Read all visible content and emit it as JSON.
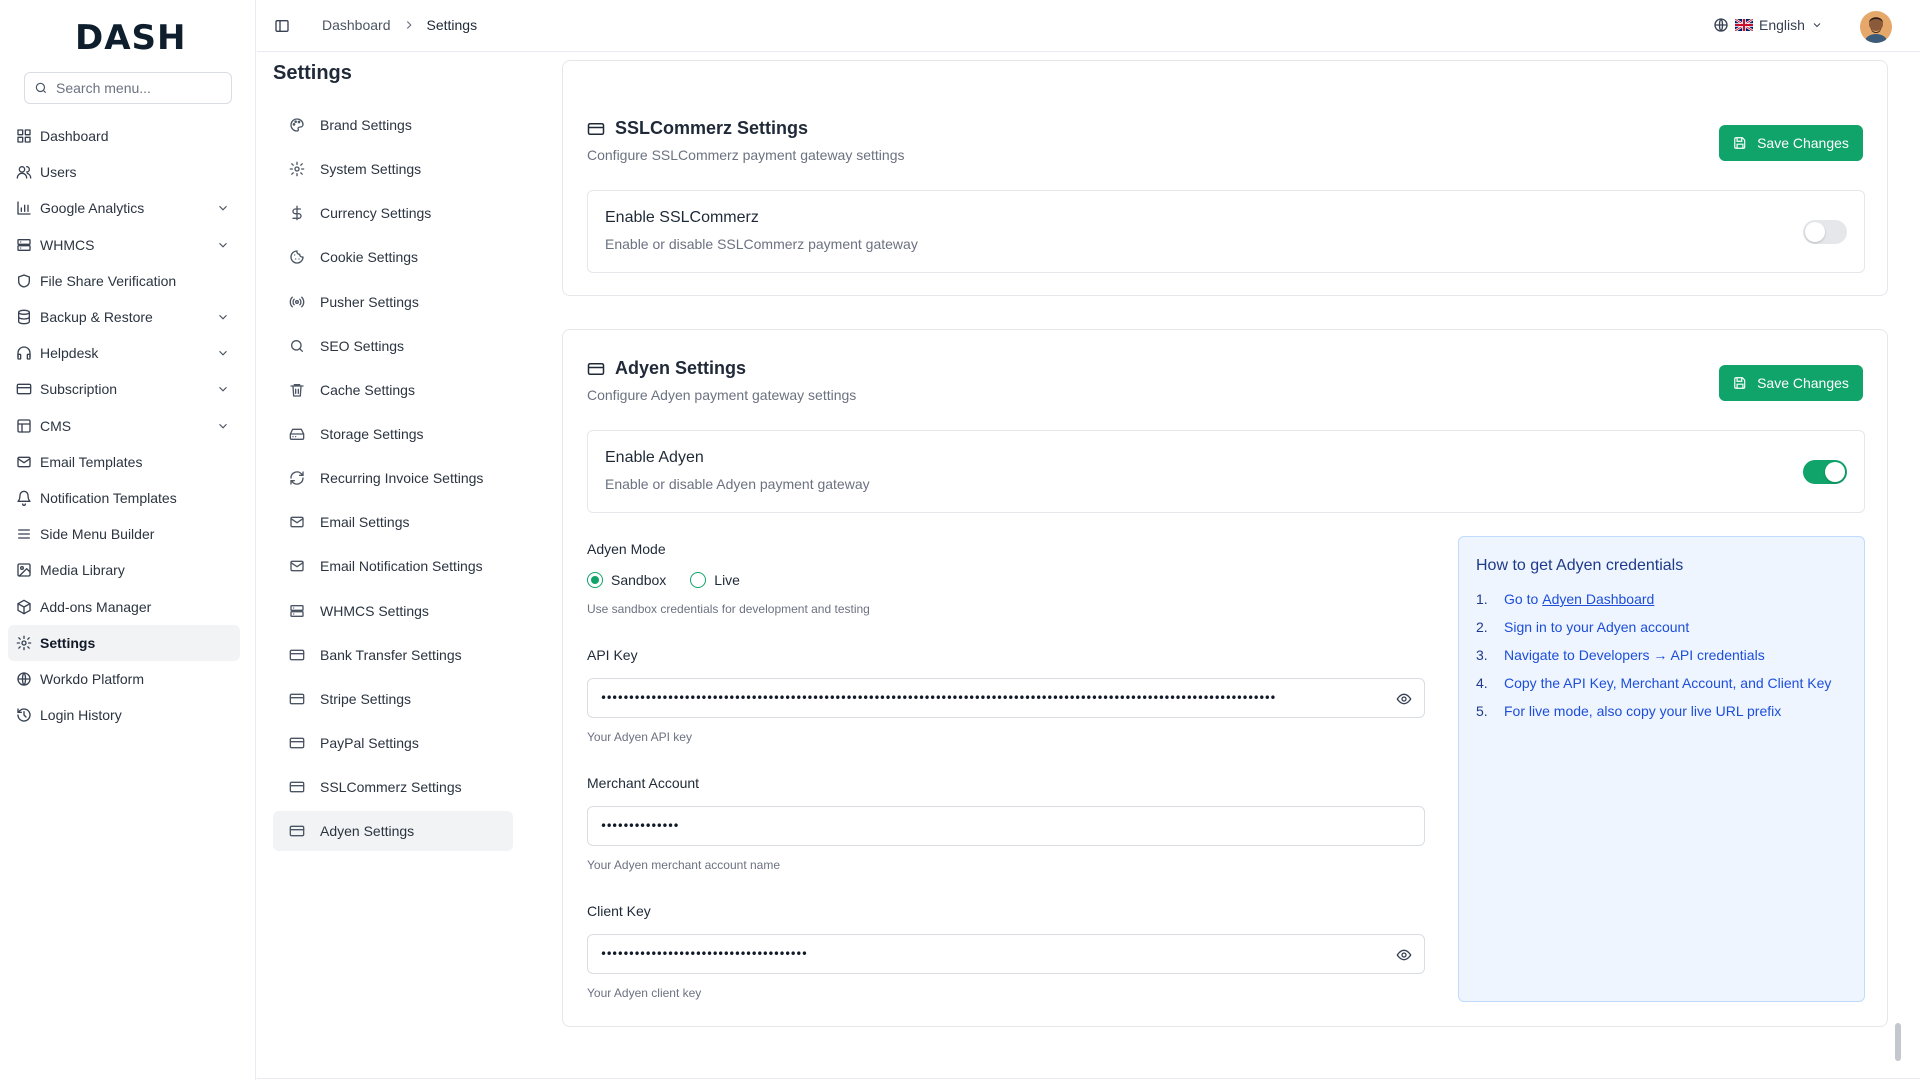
{
  "brand": {
    "logo_text": "DASH"
  },
  "search": {
    "placeholder": "Search menu..."
  },
  "sidebar": {
    "items": [
      {
        "label": "Dashboard",
        "icon": "grid-icon",
        "expandable": false
      },
      {
        "label": "Users",
        "icon": "users-icon",
        "expandable": false
      },
      {
        "label": "Google Analytics",
        "icon": "bar-chart-icon",
        "expandable": true
      },
      {
        "label": "WHMCS",
        "icon": "server-icon",
        "expandable": true
      },
      {
        "label": "File Share Verification",
        "icon": "shield-icon",
        "expandable": false
      },
      {
        "label": "Backup & Restore",
        "icon": "database-icon",
        "expandable": true
      },
      {
        "label": "Helpdesk",
        "icon": "headphones-icon",
        "expandable": true
      },
      {
        "label": "Subscription",
        "icon": "credit-card-icon",
        "expandable": true
      },
      {
        "label": "CMS",
        "icon": "layout-icon",
        "expandable": true
      },
      {
        "label": "Email Templates",
        "icon": "mail-icon",
        "expandable": false
      },
      {
        "label": "Notification Templates",
        "icon": "bell-icon",
        "expandable": false
      },
      {
        "label": "Side Menu Builder",
        "icon": "menu-icon",
        "expandable": false
      },
      {
        "label": "Media Library",
        "icon": "image-icon",
        "expandable": false
      },
      {
        "label": "Add-ons Manager",
        "icon": "package-icon",
        "expandable": false
      },
      {
        "label": "Settings",
        "icon": "gear-icon",
        "expandable": false,
        "active": true
      },
      {
        "label": "Workdo Platform",
        "icon": "globe-icon",
        "expandable": false
      },
      {
        "label": "Login History",
        "icon": "history-icon",
        "expandable": false
      }
    ]
  },
  "header": {
    "breadcrumb": [
      "Dashboard",
      "Settings"
    ],
    "language": "English"
  },
  "page": {
    "title": "Settings"
  },
  "settings_nav": {
    "items": [
      {
        "label": "Brand Settings",
        "icon": "palette-icon"
      },
      {
        "label": "System Settings",
        "icon": "gear-icon"
      },
      {
        "label": "Currency Settings",
        "icon": "dollar-icon"
      },
      {
        "label": "Cookie Settings",
        "icon": "cookie-icon"
      },
      {
        "label": "Pusher Settings",
        "icon": "radio-signal-icon"
      },
      {
        "label": "SEO Settings",
        "icon": "search-icon"
      },
      {
        "label": "Cache Settings",
        "icon": "trash-icon"
      },
      {
        "label": "Storage Settings",
        "icon": "hard-drive-icon"
      },
      {
        "label": "Recurring Invoice Settings",
        "icon": "refresh-icon"
      },
      {
        "label": "Email Settings",
        "icon": "mail-icon"
      },
      {
        "label": "Email Notification Settings",
        "icon": "mail-icon"
      },
      {
        "label": "WHMCS Settings",
        "icon": "server-icon"
      },
      {
        "label": "Bank Transfer Settings",
        "icon": "credit-card-icon"
      },
      {
        "label": "Stripe Settings",
        "icon": "credit-card-icon"
      },
      {
        "label": "PayPal Settings",
        "icon": "credit-card-icon"
      },
      {
        "label": "SSLCommerz Settings",
        "icon": "credit-card-icon"
      },
      {
        "label": "Adyen Settings",
        "icon": "credit-card-icon",
        "active": true
      }
    ]
  },
  "sslcommerz": {
    "title": "SSLCommerz Settings",
    "description": "Configure SSLCommerz payment gateway settings",
    "save_label": "Save Changes",
    "toggle_title": "Enable SSLCommerz",
    "toggle_desc": "Enable or disable SSLCommerz payment gateway",
    "enabled": false
  },
  "adyen": {
    "title": "Adyen Settings",
    "description": "Configure Adyen payment gateway settings",
    "save_label": "Save Changes",
    "toggle_title": "Enable Adyen",
    "toggle_desc": "Enable or disable Adyen payment gateway",
    "enabled": true,
    "mode_label": "Adyen Mode",
    "mode_options": [
      "Sandbox",
      "Live"
    ],
    "mode_selected": "Sandbox",
    "mode_hint": "Use sandbox credentials for development and testing",
    "api_key_label": "API Key",
    "api_key_value": "•••••••••••••••••••••••••••••••••••••••••••••••••••••••••••••••••••••••••••••••••••••••••••••••••••••••••••••••••••••••••",
    "api_key_hint": "Your Adyen API key",
    "merchant_label": "Merchant Account",
    "merchant_value": "••••••••••••••",
    "merchant_hint": "Your Adyen merchant account name",
    "client_key_label": "Client Key",
    "client_key_value": "•••••••••••••••••••••••••••••••••••••",
    "client_key_hint": "Your Adyen client key",
    "help": {
      "title": "How to get Adyen credentials",
      "steps": [
        {
          "num": "1.",
          "text": "Go to",
          "link": "Adyen Dashboard"
        },
        {
          "num": "2.",
          "text": "Sign in to your Adyen account"
        },
        {
          "num": "3.",
          "text": "Navigate to Developers → API credentials"
        },
        {
          "num": "4.",
          "text": "Copy the API Key, Merchant Account, and Client Key"
        },
        {
          "num": "5.",
          "text": "For live mode, also copy your live URL prefix"
        }
      ]
    }
  },
  "colors": {
    "accent": "#10a36a",
    "help_bg": "#eef5ff",
    "help_text": "#1d4ed8"
  }
}
